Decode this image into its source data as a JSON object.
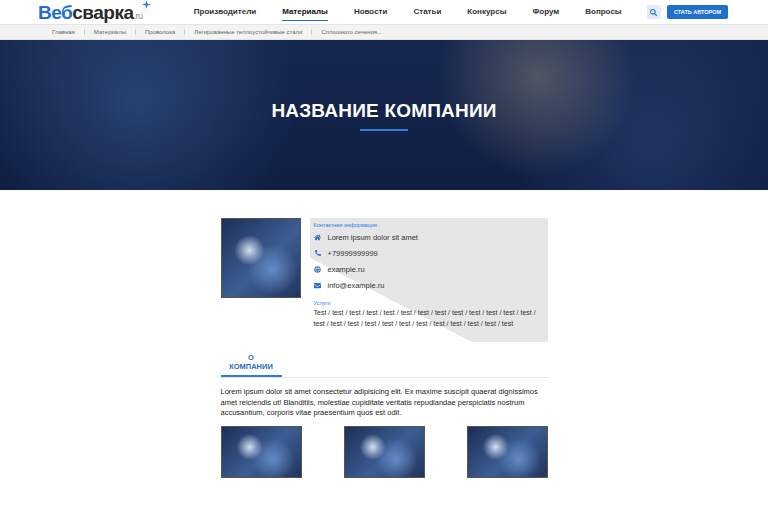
{
  "header": {
    "logo": {
      "primary": "Веб",
      "secondary": "сварка",
      "suffix": ".ru"
    },
    "nav": [
      {
        "label": "Производители",
        "selected": false
      },
      {
        "label": "Материалы",
        "selected": true
      },
      {
        "label": "Новости",
        "selected": false
      },
      {
        "label": "Статьи",
        "selected": false
      },
      {
        "label": "Конкурсы",
        "selected": false
      },
      {
        "label": "Форум",
        "selected": false
      },
      {
        "label": "Вопросы",
        "selected": false
      }
    ],
    "button": "СТАТЬ АВТОРОМ"
  },
  "breadcrumbs": [
    "Главная",
    "Материалы",
    "Проволока",
    "Легированные теплоустойчивые стали",
    "Сплошного сечения..."
  ],
  "hero": {
    "title": "НАЗВАНИЕ КОМПАНИИ"
  },
  "contacts": {
    "label": "Контактная информация",
    "items": [
      {
        "kind": "address",
        "text": "Lorem ipsum dolor sit amet"
      },
      {
        "kind": "phone",
        "text": "+79999999999"
      },
      {
        "kind": "site",
        "text": "example.ru"
      },
      {
        "kind": "email",
        "text": "info@example.ru"
      }
    ]
  },
  "services": {
    "label": "Услуги",
    "text": "Test / test / test / test / test / test / test / test / test / test / test / test / test / test / test / test / test / test / test / test / test / test / test / test / test"
  },
  "tabs": [
    {
      "label": "О КОМПАНИИ",
      "selected": true
    }
  ],
  "about": {
    "text": "Lorem ipsum dolor sit amet consectetur adipisicing elit. Ex maxime suscipit quaerat dignissimos amet reiciendis ut! Blanditiis, molestiae cupiditate veritatis repudiandae perspiciatis nostrum accusantium, corporis vitae praesentium quos est odit."
  }
}
